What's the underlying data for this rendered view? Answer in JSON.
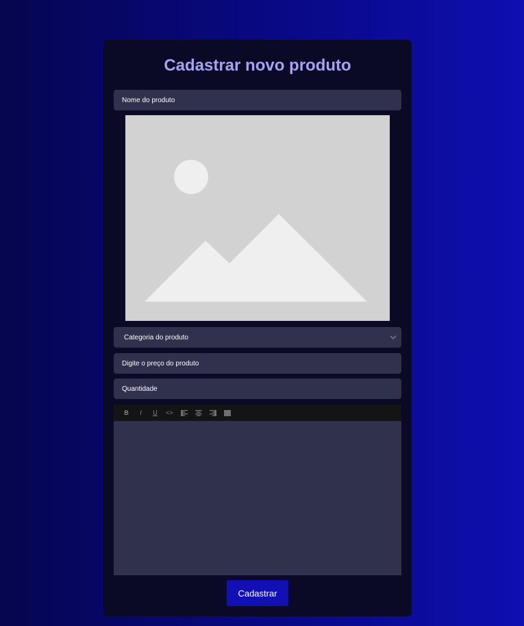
{
  "form": {
    "title": "Cadastrar novo produto",
    "name_placeholder": "Nome do produto",
    "category_placeholder": "Categoria do produto",
    "price_placeholder": "Digite o preço do produto",
    "quantity_placeholder": "Quantidade",
    "submit_label": "Cadastrar"
  },
  "image_placeholder": {
    "icon": "image-placeholder-icon"
  },
  "editor": {
    "toolbar": [
      {
        "name": "bold-button",
        "icon": "bold-icon",
        "glyph": "B"
      },
      {
        "name": "italic-button",
        "icon": "italic-icon",
        "glyph": "I"
      },
      {
        "name": "underline-button",
        "icon": "underline-icon",
        "glyph": "U"
      },
      {
        "name": "code-button",
        "icon": "code-icon",
        "glyph": "<>"
      },
      {
        "name": "align-left-button",
        "icon": "align-left-icon",
        "glyph": ""
      },
      {
        "name": "align-center-button",
        "icon": "align-center-icon",
        "glyph": ""
      },
      {
        "name": "align-right-button",
        "icon": "align-right-icon",
        "glyph": ""
      },
      {
        "name": "align-justify-button",
        "icon": "align-justify-icon",
        "glyph": ""
      }
    ],
    "content": ""
  },
  "colors": {
    "accent": "#a6a3f2",
    "button": "#1010b4",
    "card": "#0a0a26",
    "field": "#2f314d"
  }
}
